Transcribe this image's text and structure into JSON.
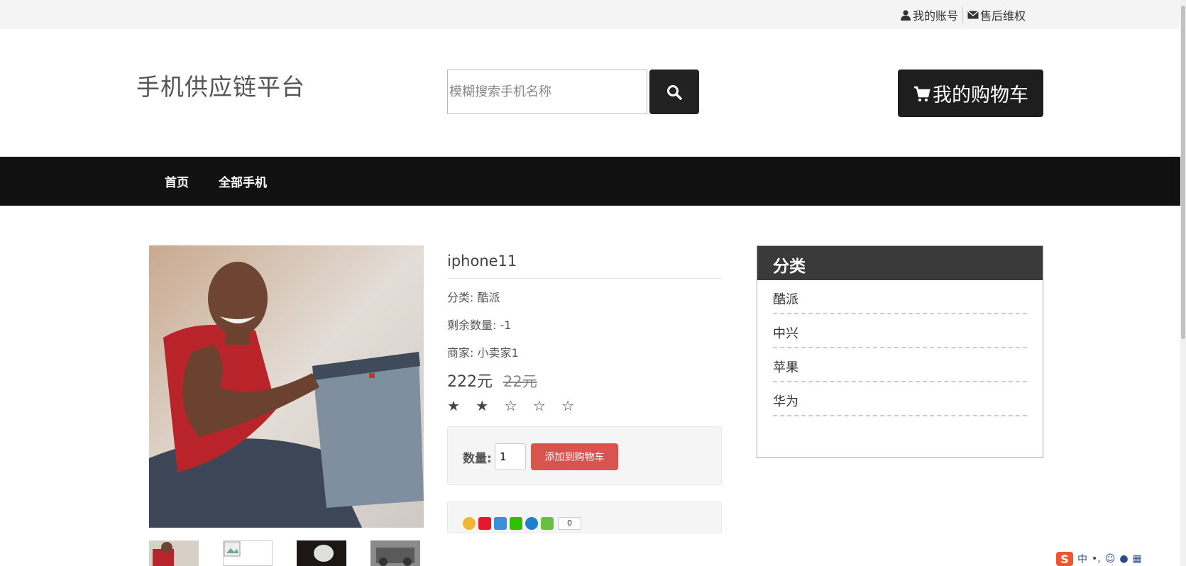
{
  "topbar": {
    "account_label": "我的账号",
    "support_label": "售后维权"
  },
  "header": {
    "logo_text": "手机供应链平台",
    "search_placeholder": "模糊搜索手机名称",
    "cart_label": "我的购物车"
  },
  "nav": {
    "items": [
      {
        "label": "首页"
      },
      {
        "label": "全部手机"
      }
    ]
  },
  "product": {
    "name": "iphone11",
    "category": "分类: 酷派",
    "stock": "剩余数量: -1",
    "seller": "商家: 小卖家1",
    "price": "222元",
    "original_price": "22元",
    "rating": 2,
    "rating_max": 5,
    "stars_text": "★ ★ ☆ ☆ ☆",
    "quantity_label": "数量:",
    "quantity_value": "1",
    "add_to_cart_label": "添加到购物车",
    "share_count": "0"
  },
  "categories": {
    "title": "分类",
    "items": [
      {
        "label": "酷派"
      },
      {
        "label": "中兴"
      },
      {
        "label": "苹果"
      },
      {
        "label": "华为"
      }
    ]
  },
  "ime": {
    "mode": "中"
  },
  "colors": {
    "nav_bg": "#111111",
    "cart_bg": "#1e1e1e",
    "add_button": "#d9534f",
    "category_header": "#3a3a3a"
  }
}
